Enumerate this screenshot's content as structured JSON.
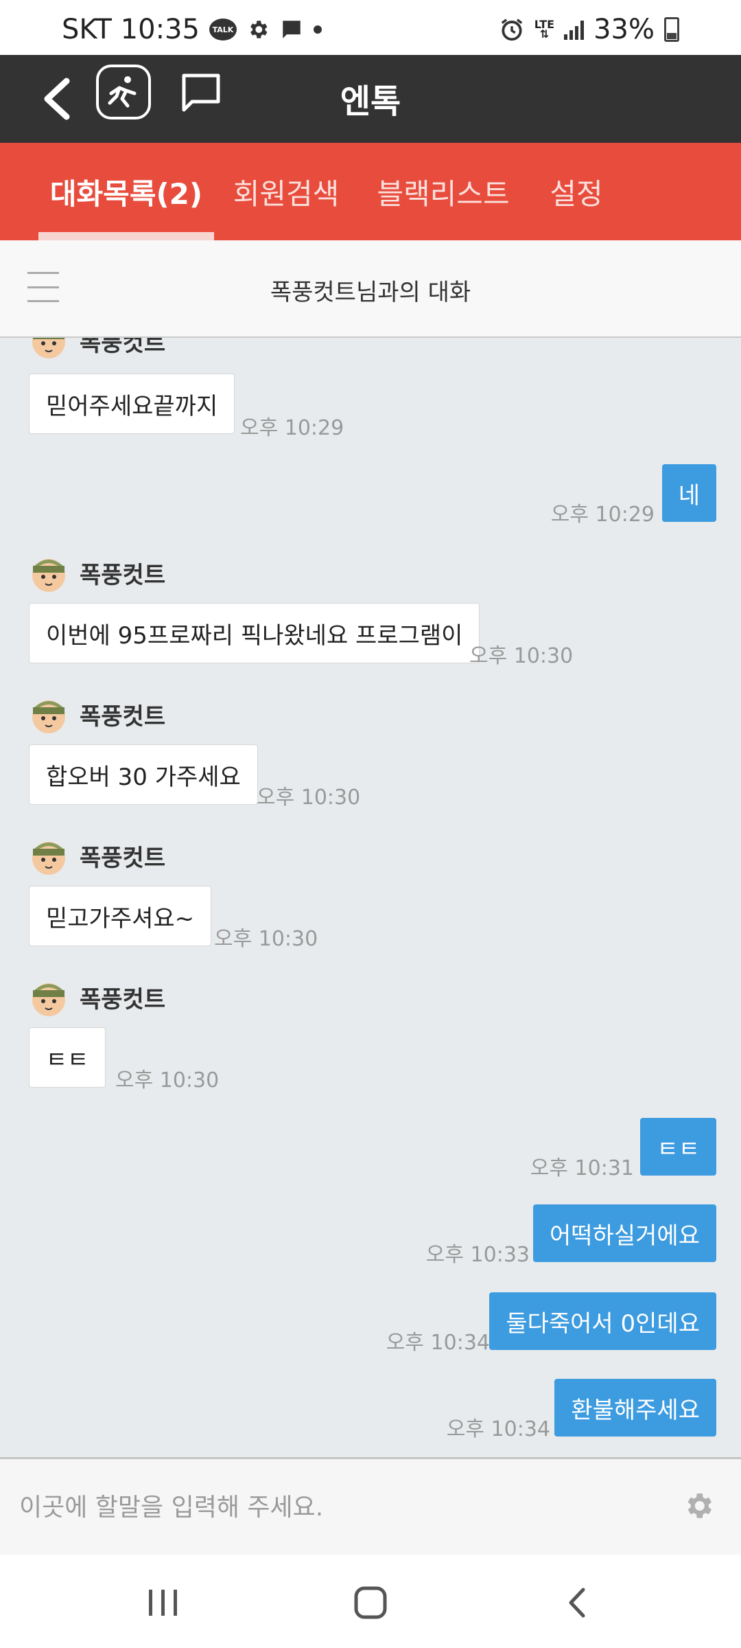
{
  "status_bar": {
    "carrier_time": "SKT 10:35",
    "talk_badge": "TALK",
    "network": "LTE",
    "battery": "33%",
    "icons": [
      "kakaotalk-icon",
      "settings-gear-icon",
      "message-icon",
      "dot-icon",
      "alarm-icon",
      "lte-icon",
      "signal-icon",
      "battery-icon"
    ]
  },
  "header": {
    "title": "엔톡",
    "icons": [
      "back-arrow-icon",
      "app-logo-icon",
      "chat-bubble-icon"
    ]
  },
  "tabs": [
    {
      "label": "대화목록(2)",
      "active": true
    },
    {
      "label": "회원검색",
      "active": false
    },
    {
      "label": "블랙리스트",
      "active": false
    },
    {
      "label": "설정",
      "active": false
    }
  ],
  "sub_header": {
    "title": "폭풍컷트님과의 대화"
  },
  "messages": [
    {
      "dir": "in",
      "sender": "폭풍컷트",
      "text": "믿어주세요끝까지",
      "time": "오후 10:29"
    },
    {
      "dir": "out",
      "text": "네",
      "time": "오후 10:29"
    },
    {
      "dir": "in",
      "sender": "폭풍컷트",
      "text": "이번에 95프로짜리 픽나왔네요 프로그램이",
      "time": "오후 10:30"
    },
    {
      "dir": "in",
      "sender": "폭풍컷트",
      "text": "합오버 30 가주세요",
      "time": "오후 10:30"
    },
    {
      "dir": "in",
      "sender": "폭풍컷트",
      "text": "믿고가주셔요~",
      "time": "오후 10:30"
    },
    {
      "dir": "in",
      "sender": "폭풍컷트",
      "text": "ㅌㅌ",
      "time": "오후 10:30"
    },
    {
      "dir": "out",
      "text": "ㅌㅌ",
      "time": "오후 10:31"
    },
    {
      "dir": "out",
      "text": "어떡하실거에요",
      "time": "오후 10:33"
    },
    {
      "dir": "out",
      "text": "둘다죽어서 0인데요",
      "time": "오후 10:34"
    },
    {
      "dir": "out",
      "text": "환불해주세요",
      "time": "오후 10:34"
    }
  ],
  "input": {
    "placeholder": "이곳에 할말을 입력해 주세요.",
    "value": ""
  },
  "colors": {
    "header_bg": "#333333",
    "tab_bg": "#e84c3d",
    "outgoing_bubble": "#3d9be0",
    "chat_bg": "#e8ebed"
  }
}
